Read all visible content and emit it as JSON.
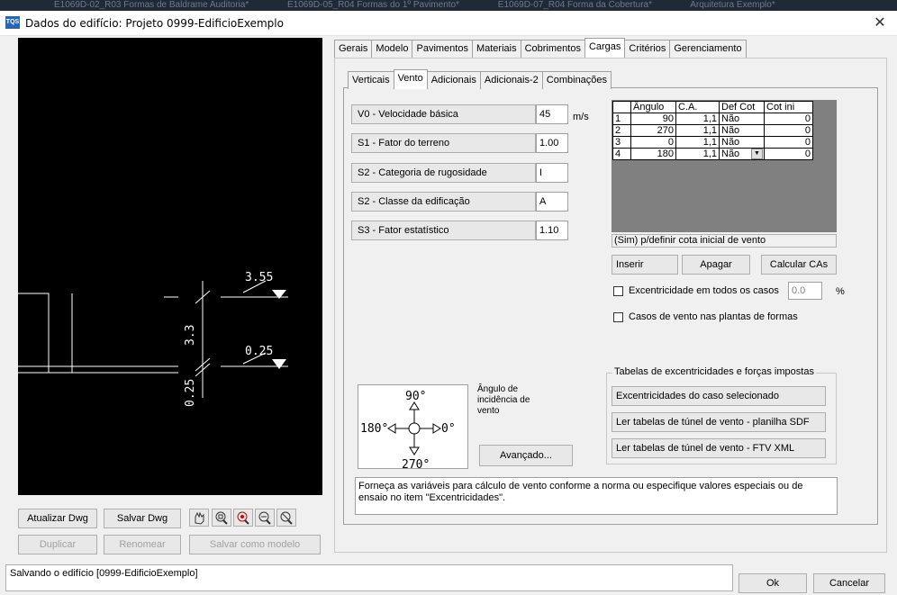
{
  "background_tabs": [
    "E1069D-02_R03 Formas de Baldrame Auditoria*",
    "E1069D-05_R04 Formas do 1º Pavimento*",
    "E1069D-07_R04 Forma da Cobertura*",
    "Arquitetura Exemplo*"
  ],
  "window": {
    "icon_text": "TQS",
    "title": "Dados do edifício: Projeto 0999-EdificioExemplo",
    "close_glyph": "✕"
  },
  "drawing": {
    "level_top": "3.55",
    "height_label": "3.3",
    "level_low": "0.25",
    "dim_low": "0.25"
  },
  "left_buttons": {
    "update": "Atualizar Dwg",
    "save": "Salvar Dwg",
    "duplicate": "Duplicar",
    "rename": "Renomear",
    "save_model": "Salvar como modelo"
  },
  "main_tabs": [
    "Gerais",
    "Modelo",
    "Pavimentos",
    "Materiais",
    "Cobrimentos",
    "Cargas",
    "Critérios",
    "Gerenciamento"
  ],
  "sub_tabs": [
    "Verticais",
    "Vento",
    "Adicionais",
    "Adicionais-2",
    "Combinações"
  ],
  "fields": [
    {
      "label": "V0 - Velocidade básica",
      "value": "45",
      "unit": "m/s"
    },
    {
      "label": "S1 - Fator do terreno",
      "value": "1.00",
      "unit": ""
    },
    {
      "label": "S2 - Categoria de rugosidade",
      "value": "I",
      "unit": ""
    },
    {
      "label": "S2 - Classe da edificação",
      "value": "A",
      "unit": ""
    },
    {
      "label": "S3 - Fator estatístico",
      "value": "1.10",
      "unit": ""
    }
  ],
  "grid": {
    "headers": [
      "Ângulo",
      "C.A.",
      "Def Cot",
      "Cot ini"
    ],
    "rows": [
      {
        "n": "1",
        "angle": "90",
        "ca": "1,1",
        "def": "Não",
        "cot": "0"
      },
      {
        "n": "2",
        "angle": "270",
        "ca": "1,1",
        "def": "Não",
        "cot": "0"
      },
      {
        "n": "3",
        "angle": "0",
        "ca": "1,1",
        "def": "Não",
        "cot": "0"
      },
      {
        "n": "4",
        "angle": "180",
        "ca": "1,1",
        "def": "Não",
        "cot": "0"
      }
    ],
    "hint": "(Sim) p/definir cota inicial de vento"
  },
  "grid_buttons": {
    "insert": "Inserir",
    "delete": "Apagar",
    "calc": "Calcular CAs"
  },
  "options": {
    "eccentricity_label": "Excentricidade em todos os casos",
    "eccentricity_value": "0.0",
    "eccentricity_unit": "%",
    "plantas_label": "Casos de vento nas plantas de formas"
  },
  "tables_group": {
    "title": "Tabelas de excentricidades e forças impostas",
    "b1": "Excentricidades do caso selecionado",
    "b2": "Ler tabelas de túnel de vento - planilha SDF",
    "b3": "Ler tabelas de túnel de vento - FTV XML"
  },
  "compass": {
    "n": "90°",
    "s": "270°",
    "w": "180°",
    "e": "0°",
    "caption": "Ângulo de incidência de vento"
  },
  "advanced_button": "Avançado...",
  "note": "Forneça as variáveis para cálculo de vento conforme a norma ou especifique valores especiais ou de ensaio no item \"Excentricidades\".",
  "status": "Salvando o edifício [0999-EdificioExemplo]",
  "footer": {
    "ok": "Ok",
    "cancel": "Cancelar"
  }
}
